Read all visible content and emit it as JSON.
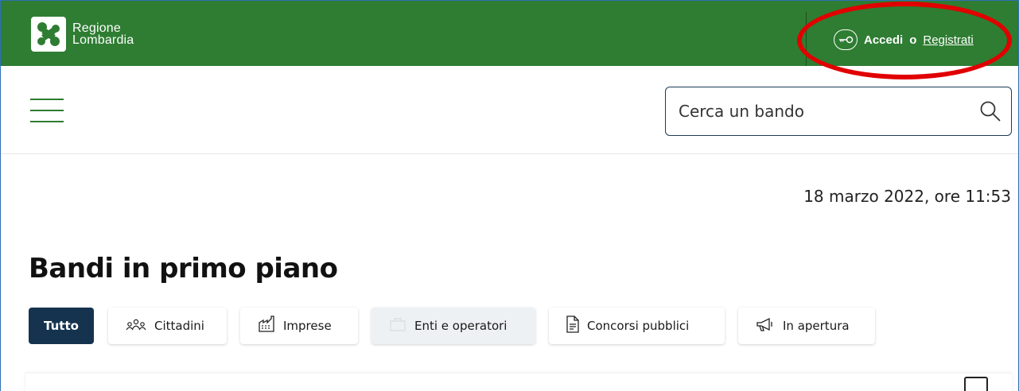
{
  "brand": {
    "line1": "Regione",
    "line2": "Lombardia",
    "color": "#2e7d32"
  },
  "auth": {
    "login_label": "Accedi",
    "conjunction": "o",
    "register_label": "Registrati",
    "icon": "key-icon"
  },
  "search": {
    "placeholder": "Cerca un bando",
    "icon": "search-icon"
  },
  "date_text": "18 marzo 2022, ore 11:53",
  "section_title": "Bandi in primo piano",
  "tabs": [
    {
      "label": "Tutto",
      "active": true
    },
    {
      "label": "Cittadini",
      "icon": "people-icon"
    },
    {
      "label": "Imprese",
      "icon": "factory-icon"
    },
    {
      "label": "Enti e operatori",
      "icon": "building-icon"
    },
    {
      "label": "Concorsi pubblici",
      "icon": "document-icon"
    },
    {
      "label": "In apertura",
      "icon": "megaphone-icon"
    }
  ],
  "colors": {
    "topbar": "#2e7d32",
    "active_tab": "#15334f",
    "annotation": "#e10000"
  }
}
